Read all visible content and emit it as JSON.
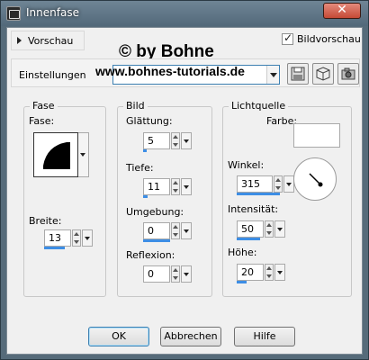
{
  "window": {
    "title": "Innenfase"
  },
  "preview": {
    "label": "Vorschau"
  },
  "watermark": {
    "line1": "© by Bohne",
    "line2": "www.bohnes-tutorials.de"
  },
  "bildvorschau": {
    "label": "Bildvorschau",
    "checked": true
  },
  "einstellungen": {
    "label": "Einstellungen"
  },
  "fase": {
    "title": "Fase",
    "fase_label": "Fase:",
    "breite_label": "Breite:",
    "breite_value": "13"
  },
  "bild": {
    "title": "Bild",
    "glaettung_label": "Glättung:",
    "glaettung_value": "5",
    "tiefe_label": "Tiefe:",
    "tiefe_value": "11",
    "umgebung_label": "Umgebung:",
    "umgebung_value": "0",
    "reflexion_label": "Reflexion:",
    "reflexion_value": "0"
  },
  "licht": {
    "title": "Lichtquelle",
    "farbe_label": "Farbe:",
    "farbe_color": "#ffffff",
    "winkel_label": "Winkel:",
    "winkel_value": "315",
    "intensitaet_label": "Intensität:",
    "intensitaet_value": "50",
    "hoehe_label": "Höhe:",
    "hoehe_value": "20"
  },
  "buttons": {
    "ok": "OK",
    "abbrechen": "Abbrechen",
    "hilfe": "Hilfe"
  },
  "colors": {
    "accent": "#3d8ee5",
    "title_bar": "#566b7a",
    "close": "#c54a36"
  },
  "icons": [
    "app-icon",
    "close-icon",
    "save-icon",
    "cube-icon",
    "camera-icon",
    "chevron-down-icon",
    "spin-up-icon",
    "spin-down-icon"
  ]
}
